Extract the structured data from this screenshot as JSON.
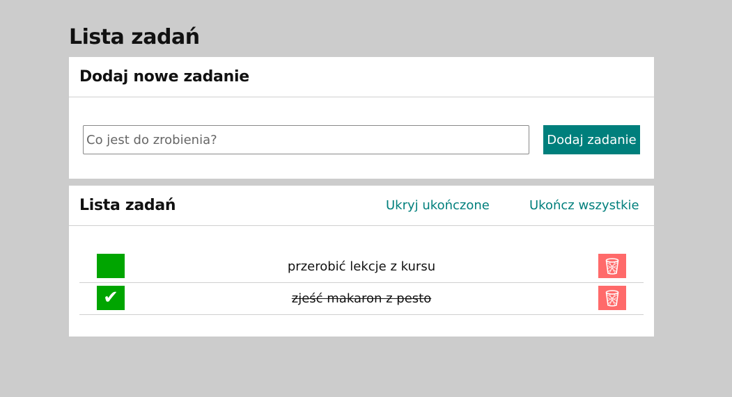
{
  "page": {
    "title": "Lista zadań"
  },
  "add_card": {
    "title": "Dodaj nowe zadanie",
    "input_placeholder": "Co jest do zrobienia?",
    "input_value": "",
    "add_button_label": "Dodaj zadanie"
  },
  "list_card": {
    "title": "Lista zadań",
    "hide_completed_label": "Ukryj ukończone",
    "complete_all_label": "Ukończ wszystkie",
    "tasks": [
      {
        "text": "przerobić lekcje z kursu",
        "done": false,
        "check_glyph": ""
      },
      {
        "text": "zjeść makaron z pesto",
        "done": true,
        "check_glyph": "✔"
      }
    ]
  },
  "icons": {
    "delete": "trash-icon",
    "check": "checkmark-icon"
  },
  "colors": {
    "background": "#cccccc",
    "accent": "#007f7c",
    "check_green": "#00a500",
    "delete_red": "#ff6a6a"
  }
}
